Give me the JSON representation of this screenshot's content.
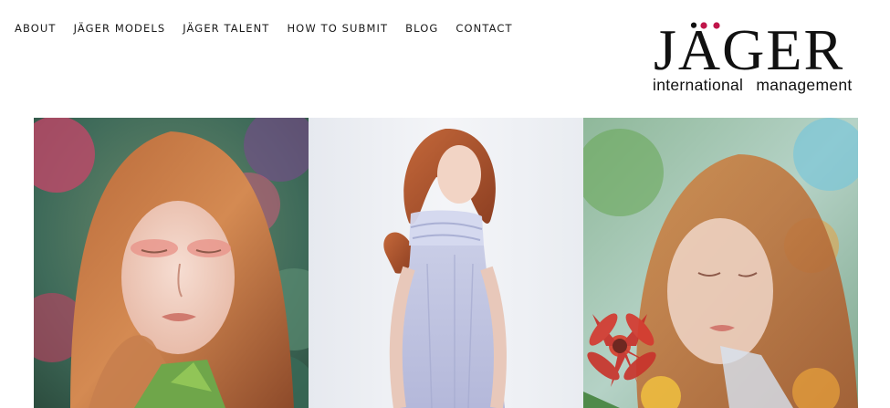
{
  "nav": {
    "items": [
      {
        "label": "ABOUT"
      },
      {
        "label": "JÄGER MODELS"
      },
      {
        "label": "JÄGER TALENT"
      },
      {
        "label": "HOW TO SUBMIT"
      },
      {
        "label": "BLOG"
      },
      {
        "label": "CONTACT"
      }
    ]
  },
  "logo": {
    "wordmark": "JÄGER",
    "subtitle": "international management",
    "accent_color": "#c0154a"
  },
  "gallery": {
    "photos": [
      {
        "icon": "portrait-floral-closed-eyes-image"
      },
      {
        "icon": "portrait-white-background-dress-image"
      },
      {
        "icon": "portrait-floral-double-exposure-image"
      }
    ]
  }
}
